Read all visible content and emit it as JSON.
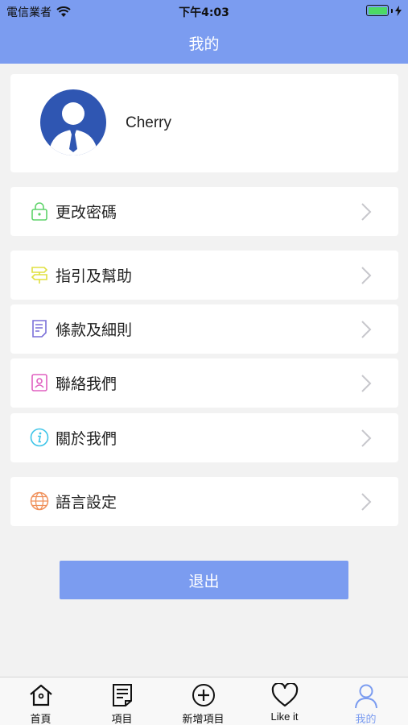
{
  "status_bar": {
    "carrier": "電信業者",
    "time": "下午4:03"
  },
  "header": {
    "title": "我的"
  },
  "profile": {
    "name": "Cherry"
  },
  "menu": [
    {
      "label": "更改密碼",
      "icon": "lock-icon",
      "color": "#5fd36a"
    },
    {
      "label": "指引及幫助",
      "icon": "signpost-icon",
      "color": "#e0e040"
    },
    {
      "label": "條款及細則",
      "icon": "document-icon",
      "color": "#7a6fd8"
    },
    {
      "label": "聯絡我們",
      "icon": "contact-card-icon",
      "color": "#e060c0"
    },
    {
      "label": "關於我們",
      "icon": "info-icon",
      "color": "#3cc4e8"
    },
    {
      "label": "語言設定",
      "icon": "globe-icon",
      "color": "#f0905a"
    }
  ],
  "logout": {
    "label": "退出"
  },
  "tabs": [
    {
      "label": "首頁",
      "icon": "home-icon"
    },
    {
      "label": "項目",
      "icon": "document-list-icon"
    },
    {
      "label": "新增項目",
      "icon": "add-circle-icon"
    },
    {
      "label": "Like it",
      "icon": "heart-icon"
    },
    {
      "label": "我的",
      "icon": "user-icon",
      "active": true
    }
  ],
  "colors": {
    "accent": "#7b9cf0",
    "avatar_bg": "#2f56b2",
    "background": "#f2f2f2"
  }
}
